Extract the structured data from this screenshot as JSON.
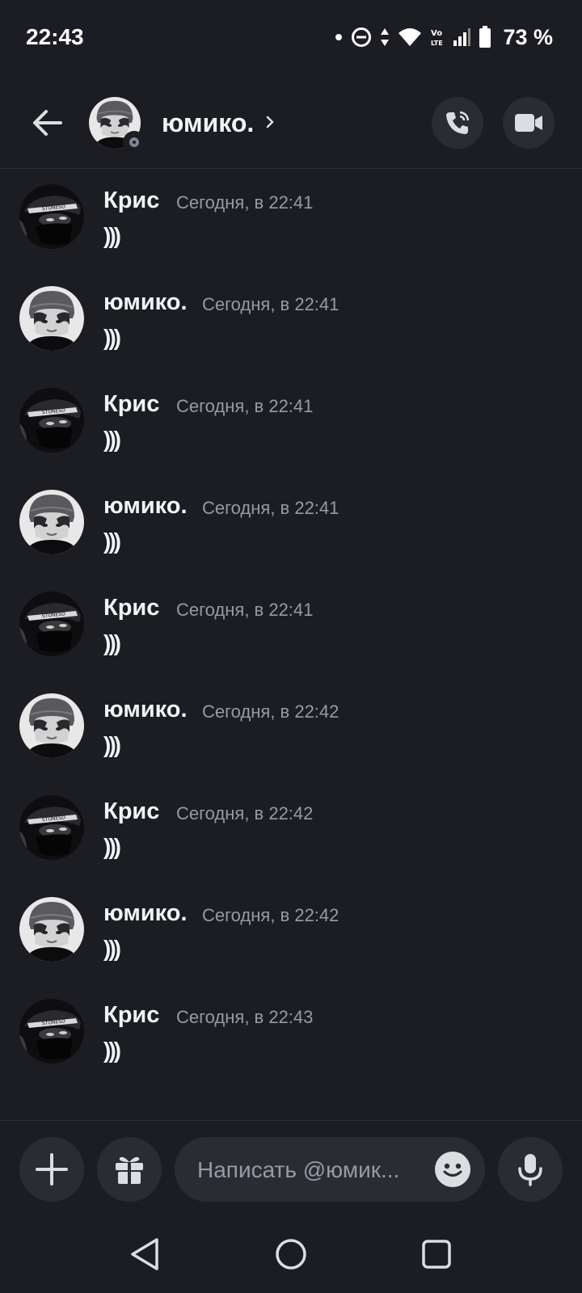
{
  "status_bar": {
    "time": "22:43",
    "battery": "73 %",
    "icons": [
      "notification-dot",
      "do-not-disturb-icon",
      "data-arrows-icon",
      "wifi-icon",
      "volte-icon",
      "signal-icon",
      "battery-icon"
    ]
  },
  "header": {
    "name": "юмико.",
    "back_icon": "arrow-left-icon",
    "call_icon": "phone-icon",
    "video_icon": "video-camera-icon"
  },
  "messages": [
    {
      "author": "Крис",
      "time": "Сегодня, в 22:41",
      "text": ")))"
    },
    {
      "author": "юмико.",
      "time": "Сегодня, в 22:41",
      "text": ")))"
    },
    {
      "author": "Крис",
      "time": "Сегодня, в 22:41",
      "text": ")))"
    },
    {
      "author": "юмико.",
      "time": "Сегодня, в 22:41",
      "text": ")))"
    },
    {
      "author": "Крис",
      "time": "Сегодня, в 22:41",
      "text": ")))"
    },
    {
      "author": "юмико.",
      "time": "Сегодня, в 22:42",
      "text": ")))"
    },
    {
      "author": "Крис",
      "time": "Сегодня, в 22:42",
      "text": ")))"
    },
    {
      "author": "юмико.",
      "time": "Сегодня, в 22:42",
      "text": ")))"
    },
    {
      "author": "Крис",
      "time": "Сегодня, в 22:43",
      "text": ")))"
    }
  ],
  "composer": {
    "placeholder": "Написать @юмик..."
  },
  "colors": {
    "background": "#1c1d23",
    "surface": "#2b2c33",
    "muted_text": "#949ba4",
    "text": "#f2f3f5"
  }
}
